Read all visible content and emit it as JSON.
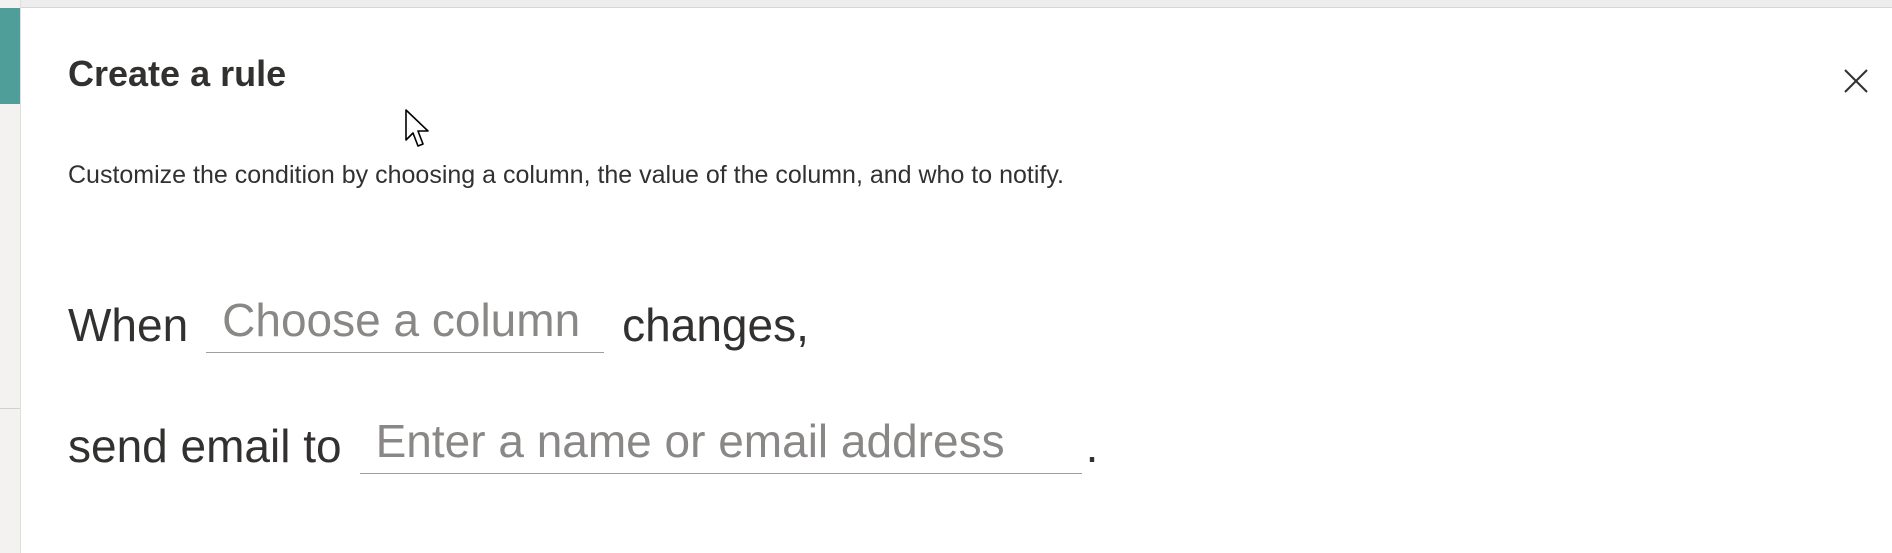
{
  "dialog": {
    "title": "Create a rule",
    "description": "Customize the condition by choosing a column, the value of the column, and who to notify.",
    "close_icon": "close-icon"
  },
  "rule": {
    "when_label": "When",
    "column_placeholder": "Choose a column",
    "changes_label": "changes,",
    "send_label": "send email to",
    "email_placeholder": "Enter a name or email address",
    "end_period": "."
  }
}
